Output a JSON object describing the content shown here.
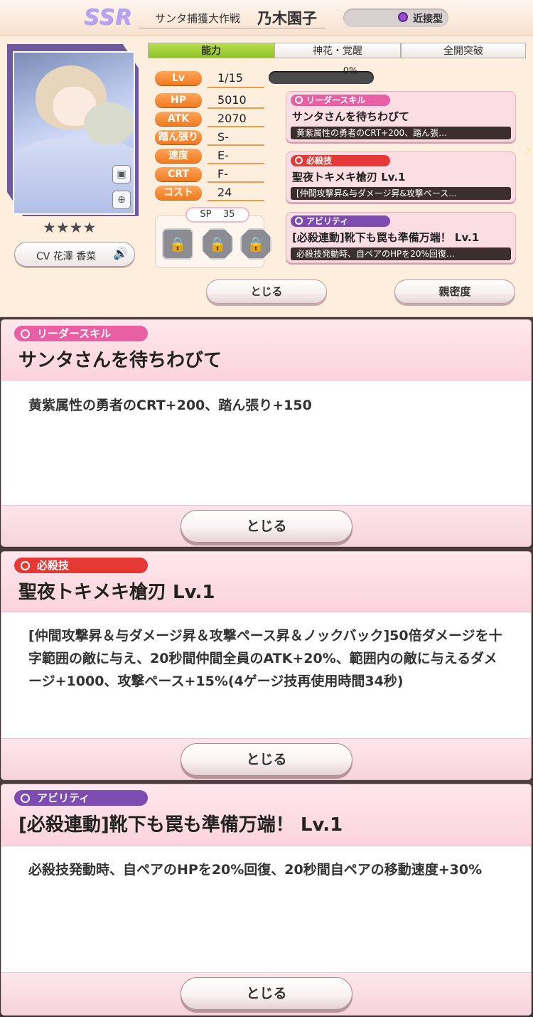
{
  "header": {
    "rarity": "SSR",
    "event_title": "サンタ捕獲大作戦",
    "character_name": "乃木園子",
    "type_label": "近接型"
  },
  "tabs": [
    {
      "label": "能力",
      "active": true
    },
    {
      "label": "神花・覚醒",
      "active": false
    },
    {
      "label": "全開突破",
      "active": false
    }
  ],
  "stats": [
    {
      "label": "Lv",
      "value": "1/15"
    },
    {
      "label": "HP",
      "value": "5010"
    },
    {
      "label": "ATK",
      "value": "2070"
    },
    {
      "label": "踏ん張り",
      "value": "S-"
    },
    {
      "label": "速度",
      "value": "E-"
    },
    {
      "label": "CRT",
      "value": "F-"
    },
    {
      "label": "コスト",
      "value": "24"
    }
  ],
  "exp": {
    "text": "0%",
    "fraction": 0.0
  },
  "stars": "★★★★",
  "cv": {
    "text": "CV 花澤 香菜"
  },
  "sp": {
    "label": "SP",
    "value": "35"
  },
  "skills": {
    "leader": {
      "tag": "リーダースキル",
      "name": "サンタさんを待ちわびて",
      "short_desc": "黄紫属性の勇者のCRT+200、踏ん張…",
      "color": "#e85fa6"
    },
    "special": {
      "tag": "必殺技",
      "name": "聖夜トキメキ槍刃 Lv.1",
      "short_desc": "[仲間攻撃昇&与ダメージ昇&攻撃ペース…",
      "color": "#e53935"
    },
    "ability": {
      "tag": "アビリティ",
      "name": "[必殺連動]靴下も罠も準備万端！ Lv.1",
      "short_desc": "必殺技発動時、自ペアのHPを20%回復…",
      "color": "#7e4bb0"
    }
  },
  "buttons": {
    "close": "とじる",
    "affinity": "親密度"
  },
  "panels": [
    {
      "tag": "リーダースキル",
      "title": "サンタさんを待ちわびて",
      "body": "黄紫属性の勇者のCRT+200、踏ん張り+150",
      "close": "とじる"
    },
    {
      "tag": "必殺技",
      "title": "聖夜トキメキ槍刃 Lv.1",
      "body": "[仲間攻撃昇＆与ダメージ昇＆攻撃ペース昇＆ノックバック]50倍ダメージを十字範囲の敵に与え、20秒間仲間全員のATK+20%、範囲内の敵に与えるダメージ+1000、攻撃ペース+15%(4ゲージ技再使用時間34秒)",
      "close": "とじる"
    },
    {
      "tag": "アビリティ",
      "title": "[必殺連動]靴下も罠も準備万端！ Lv.1",
      "body": "必殺技発動時、自ペアのHPを20%回復、20秒間自ペアの移動速度+30%",
      "close": "とじる"
    }
  ]
}
